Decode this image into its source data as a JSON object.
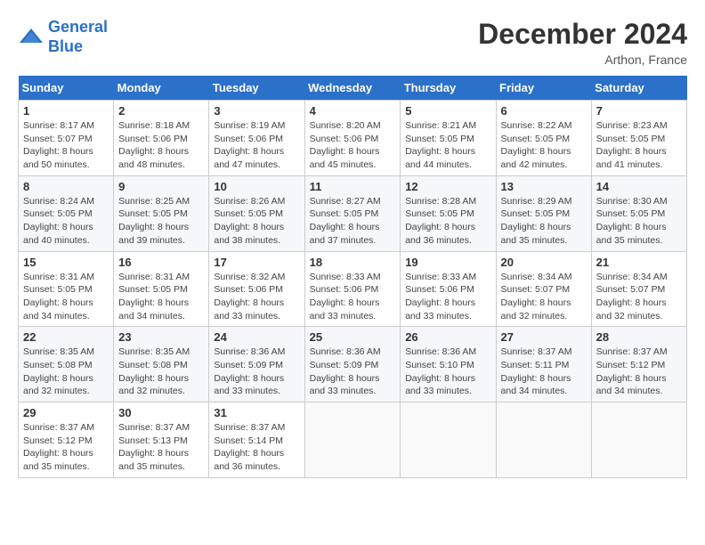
{
  "logo": {
    "line1": "General",
    "line2": "Blue"
  },
  "title": "December 2024",
  "subtitle": "Arthon, France",
  "header": {
    "days": [
      "Sunday",
      "Monday",
      "Tuesday",
      "Wednesday",
      "Thursday",
      "Friday",
      "Saturday"
    ]
  },
  "weeks": [
    [
      {
        "day": "1",
        "sunrise": "8:17 AM",
        "sunset": "5:07 PM",
        "daylight": "8 hours and 50 minutes."
      },
      {
        "day": "2",
        "sunrise": "8:18 AM",
        "sunset": "5:06 PM",
        "daylight": "8 hours and 48 minutes."
      },
      {
        "day": "3",
        "sunrise": "8:19 AM",
        "sunset": "5:06 PM",
        "daylight": "8 hours and 47 minutes."
      },
      {
        "day": "4",
        "sunrise": "8:20 AM",
        "sunset": "5:06 PM",
        "daylight": "8 hours and 45 minutes."
      },
      {
        "day": "5",
        "sunrise": "8:21 AM",
        "sunset": "5:05 PM",
        "daylight": "8 hours and 44 minutes."
      },
      {
        "day": "6",
        "sunrise": "8:22 AM",
        "sunset": "5:05 PM",
        "daylight": "8 hours and 42 minutes."
      },
      {
        "day": "7",
        "sunrise": "8:23 AM",
        "sunset": "5:05 PM",
        "daylight": "8 hours and 41 minutes."
      }
    ],
    [
      {
        "day": "8",
        "sunrise": "8:24 AM",
        "sunset": "5:05 PM",
        "daylight": "8 hours and 40 minutes."
      },
      {
        "day": "9",
        "sunrise": "8:25 AM",
        "sunset": "5:05 PM",
        "daylight": "8 hours and 39 minutes."
      },
      {
        "day": "10",
        "sunrise": "8:26 AM",
        "sunset": "5:05 PM",
        "daylight": "8 hours and 38 minutes."
      },
      {
        "day": "11",
        "sunrise": "8:27 AM",
        "sunset": "5:05 PM",
        "daylight": "8 hours and 37 minutes."
      },
      {
        "day": "12",
        "sunrise": "8:28 AM",
        "sunset": "5:05 PM",
        "daylight": "8 hours and 36 minutes."
      },
      {
        "day": "13",
        "sunrise": "8:29 AM",
        "sunset": "5:05 PM",
        "daylight": "8 hours and 35 minutes."
      },
      {
        "day": "14",
        "sunrise": "8:30 AM",
        "sunset": "5:05 PM",
        "daylight": "8 hours and 35 minutes."
      }
    ],
    [
      {
        "day": "15",
        "sunrise": "8:31 AM",
        "sunset": "5:05 PM",
        "daylight": "8 hours and 34 minutes."
      },
      {
        "day": "16",
        "sunrise": "8:31 AM",
        "sunset": "5:05 PM",
        "daylight": "8 hours and 34 minutes."
      },
      {
        "day": "17",
        "sunrise": "8:32 AM",
        "sunset": "5:06 PM",
        "daylight": "8 hours and 33 minutes."
      },
      {
        "day": "18",
        "sunrise": "8:33 AM",
        "sunset": "5:06 PM",
        "daylight": "8 hours and 33 minutes."
      },
      {
        "day": "19",
        "sunrise": "8:33 AM",
        "sunset": "5:06 PM",
        "daylight": "8 hours and 33 minutes."
      },
      {
        "day": "20",
        "sunrise": "8:34 AM",
        "sunset": "5:07 PM",
        "daylight": "8 hours and 32 minutes."
      },
      {
        "day": "21",
        "sunrise": "8:34 AM",
        "sunset": "5:07 PM",
        "daylight": "8 hours and 32 minutes."
      }
    ],
    [
      {
        "day": "22",
        "sunrise": "8:35 AM",
        "sunset": "5:08 PM",
        "daylight": "8 hours and 32 minutes."
      },
      {
        "day": "23",
        "sunrise": "8:35 AM",
        "sunset": "5:08 PM",
        "daylight": "8 hours and 32 minutes."
      },
      {
        "day": "24",
        "sunrise": "8:36 AM",
        "sunset": "5:09 PM",
        "daylight": "8 hours and 33 minutes."
      },
      {
        "day": "25",
        "sunrise": "8:36 AM",
        "sunset": "5:09 PM",
        "daylight": "8 hours and 33 minutes."
      },
      {
        "day": "26",
        "sunrise": "8:36 AM",
        "sunset": "5:10 PM",
        "daylight": "8 hours and 33 minutes."
      },
      {
        "day": "27",
        "sunrise": "8:37 AM",
        "sunset": "5:11 PM",
        "daylight": "8 hours and 34 minutes."
      },
      {
        "day": "28",
        "sunrise": "8:37 AM",
        "sunset": "5:12 PM",
        "daylight": "8 hours and 34 minutes."
      }
    ],
    [
      {
        "day": "29",
        "sunrise": "8:37 AM",
        "sunset": "5:12 PM",
        "daylight": "8 hours and 35 minutes."
      },
      {
        "day": "30",
        "sunrise": "8:37 AM",
        "sunset": "5:13 PM",
        "daylight": "8 hours and 35 minutes."
      },
      {
        "day": "31",
        "sunrise": "8:37 AM",
        "sunset": "5:14 PM",
        "daylight": "8 hours and 36 minutes."
      },
      null,
      null,
      null,
      null
    ]
  ]
}
